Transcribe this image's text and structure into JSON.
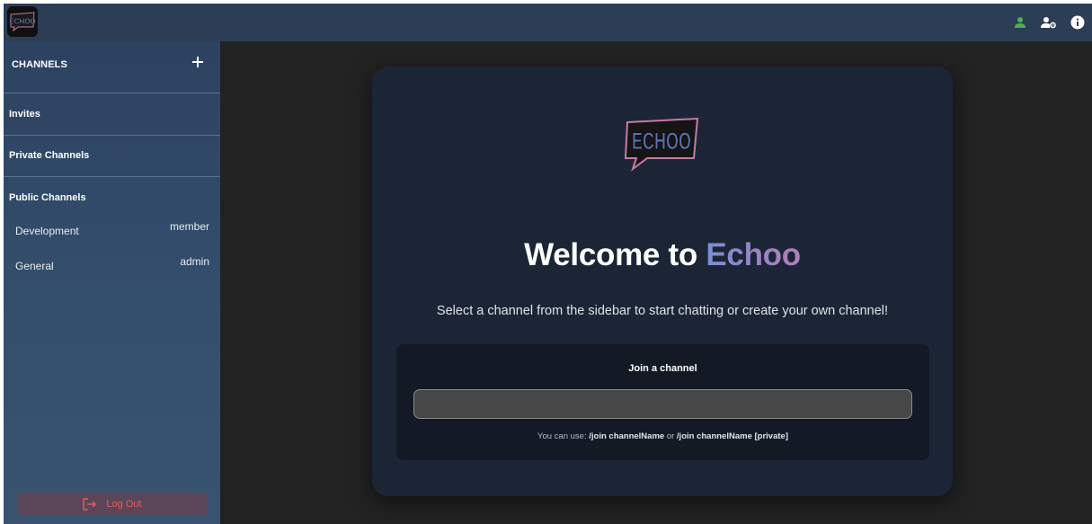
{
  "app": {
    "logo_text": "ECHOO"
  },
  "topbar": {
    "icons": [
      "user-icon",
      "user-settings-icon",
      "info-icon"
    ],
    "colors": {
      "user_icon": "#4caf50",
      "bar": "#2c3e55"
    }
  },
  "sidebar": {
    "title": "CHANNELS",
    "add_icon": "plus-icon",
    "sections": {
      "invites": "Invites",
      "private": "Private Channels",
      "public": "Public Channels"
    },
    "public_channels": [
      {
        "name": "Development",
        "role": "member"
      },
      {
        "name": "General",
        "role": "admin"
      }
    ],
    "logout_label": "Log Out",
    "logout_icon": "logout-icon"
  },
  "main": {
    "logo_text": "ECHOO",
    "welcome_prefix": "Welcome to ",
    "welcome_brand": "Echoo",
    "subtitle": "Select a channel from the sidebar to start chatting or create your own channel!",
    "join": {
      "title": "Join a channel",
      "input_value": "",
      "hint_prefix": "You can use: ",
      "hint_cmd1": "/join channelName",
      "hint_mid": " or ",
      "hint_cmd2": "/join channelName [private]"
    }
  },
  "colors": {
    "background": "#222222",
    "sidebar": "#2c4260",
    "card": "#1c2535",
    "logout_text": "#e65a5a"
  }
}
